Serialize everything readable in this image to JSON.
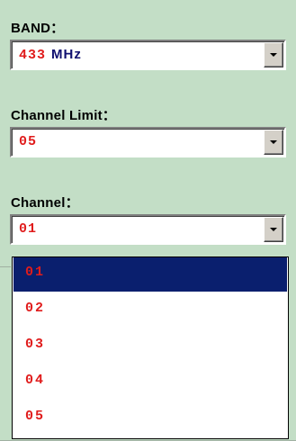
{
  "band": {
    "label": "BAND：",
    "value_number": "433",
    "value_unit": "MHz"
  },
  "channel_limit": {
    "label": "Channel Limit：",
    "value": "05"
  },
  "channel": {
    "label": "Channel：",
    "value": "01",
    "options": [
      "01",
      "02",
      "03",
      "04",
      "05"
    ],
    "selected_index": 0
  },
  "icons": {
    "dropdown_arrow": "chevron-down-icon"
  },
  "colors": {
    "background": "#c3dec6",
    "value_text": "#e01c1c",
    "unit_text": "#101070",
    "selection_highlight": "#0a1f6e"
  }
}
